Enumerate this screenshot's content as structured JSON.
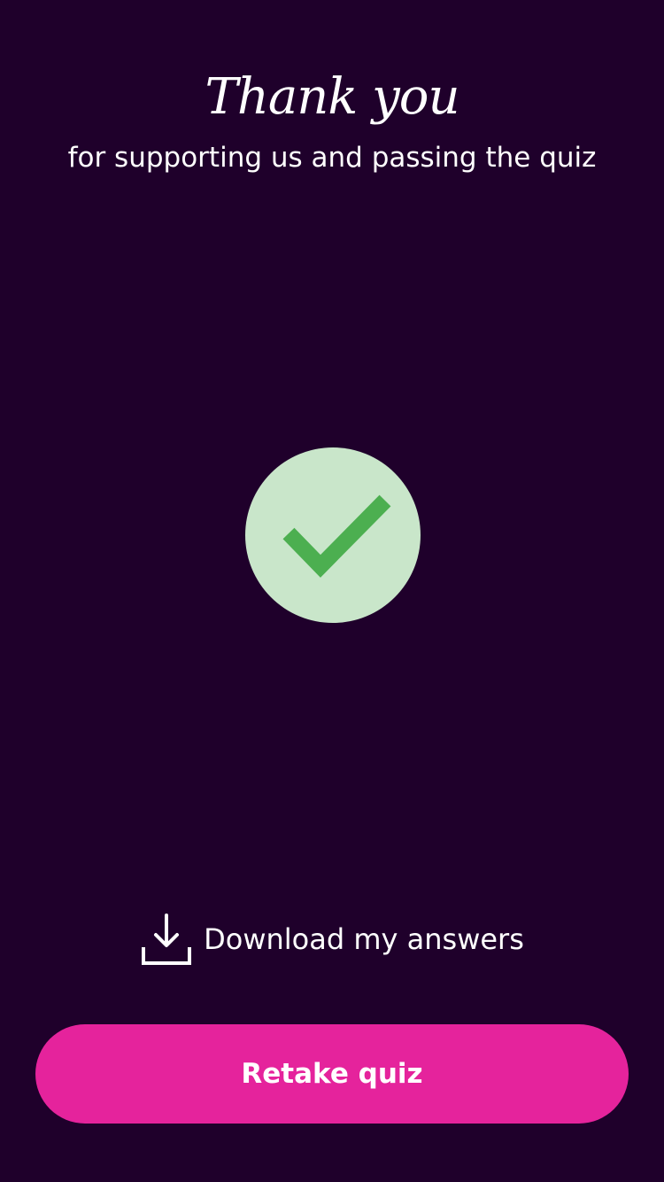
{
  "header": {
    "title": "Thank you",
    "subtitle": "for supporting us and passing the quiz"
  },
  "status": {
    "icon": "check-circle-icon",
    "circle_color": "#c9e6ca",
    "check_color": "#4caf50"
  },
  "download": {
    "icon": "download-icon",
    "label": "Download my answers"
  },
  "actions": {
    "retake_label": "Retake quiz",
    "retake_color": "#e5239c"
  },
  "theme": {
    "background": "#1f002b",
    "text": "#ffffff"
  }
}
